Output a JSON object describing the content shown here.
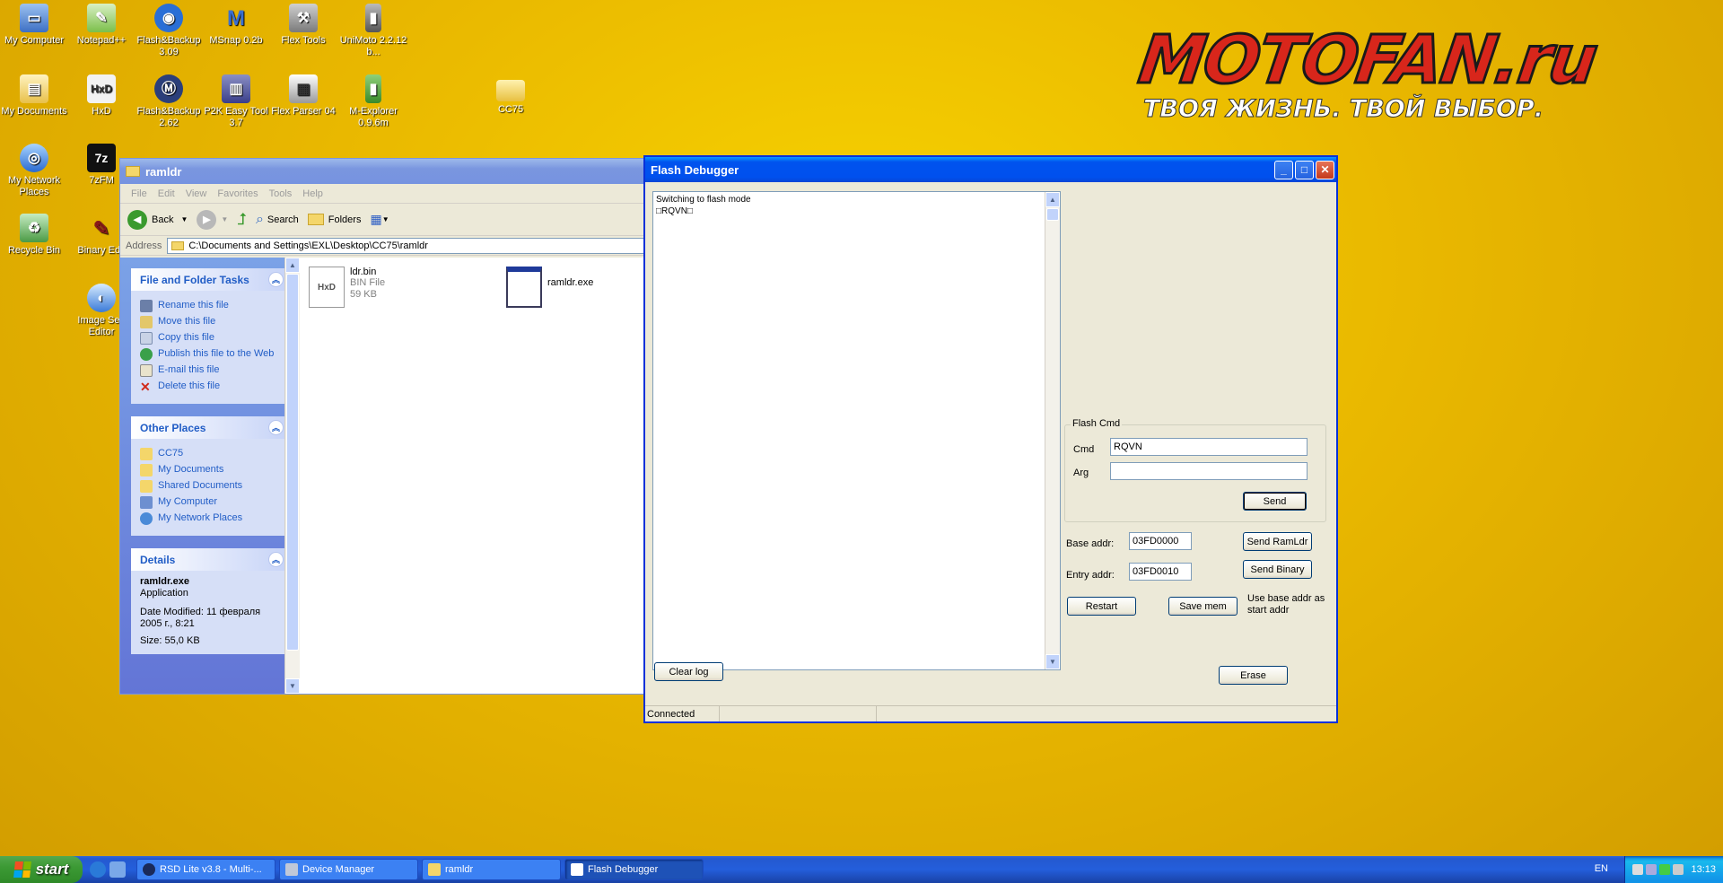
{
  "desktop": {
    "icons": [
      {
        "label": "My Computer"
      },
      {
        "label": "Notepad++"
      },
      {
        "label": "Flash&Backup 3.09"
      },
      {
        "label": "MSnap 0.2b"
      },
      {
        "label": "Flex Tools"
      },
      {
        "label": "UniMoto 2.2.12 b..."
      },
      {
        "label": "My Documents"
      },
      {
        "label": "HxD"
      },
      {
        "label": "Flash&Backup 2.62"
      },
      {
        "label": "P2K Easy Tool 3.7"
      },
      {
        "label": "Flex Parser 04"
      },
      {
        "label": "M-Explorer 0.9.6m"
      },
      {
        "label": "CC75"
      },
      {
        "label": "My Network Places"
      },
      {
        "label": "7zFM"
      },
      {
        "label": "Recycle Bin"
      },
      {
        "label": "Binary Edit"
      },
      {
        "label": "Image Sea Editor"
      }
    ],
    "logo": {
      "brand": "MOTOFAN.ru",
      "slogan": "ТВОЯ ЖИЗНЬ. ТВОЙ ВЫБОР."
    }
  },
  "explorer": {
    "title": "ramldr",
    "menu": [
      "File",
      "Edit",
      "View",
      "Favorites",
      "Tools",
      "Help"
    ],
    "toolbar": {
      "back": "Back",
      "search": "Search",
      "folders": "Folders"
    },
    "address_label": "Address",
    "address_value": "C:\\Documents and Settings\\EXL\\Desktop\\CC75\\ramldr",
    "tasks": {
      "title": "File and Folder Tasks",
      "items": [
        "Rename this file",
        "Move this file",
        "Copy this file",
        "Publish this file to the Web",
        "E-mail this file",
        "Delete this file"
      ]
    },
    "places": {
      "title": "Other Places",
      "items": [
        "CC75",
        "My Documents",
        "Shared Documents",
        "My Computer",
        "My Network Places"
      ]
    },
    "details": {
      "title": "Details",
      "name": "ramldr.exe",
      "type": "Application",
      "modified": "Date Modified: 11 февраля 2005 г., 8:21",
      "size": "Size: 55,0 KB"
    },
    "files": [
      {
        "name": "ldr.bin",
        "type": "BIN File",
        "size": "59 KB"
      },
      {
        "name": "ramldr.exe"
      }
    ]
  },
  "debugger": {
    "title": "Flash Debugger",
    "log_lines": [
      "Switching to flash mode",
      "□RQVN□"
    ],
    "flash_cmd_group": "Flash Cmd",
    "cmd_label": "Cmd",
    "cmd_value": "RQVN",
    "arg_label": "Arg",
    "arg_value": "",
    "send": "Send",
    "base_addr_label": "Base addr:",
    "base_addr_value": "03FD0000",
    "entry_addr_label": "Entry addr:",
    "entry_addr_value": "03FD0010",
    "send_ramldr": "Send RamLdr",
    "send_binary": "Send Binary",
    "restart": "Restart",
    "save_mem": "Save mem",
    "use_base_text": "Use base addr as start addr",
    "clear_log": "Clear log",
    "erase": "Erase",
    "status": "Connected"
  },
  "taskbar": {
    "start": "start",
    "tasks": [
      "RSD Lite v3.8 - Multi-...",
      "Device Manager",
      "ramldr",
      "Flash Debugger"
    ],
    "lang": "EN",
    "clock": "13:13"
  },
  "colors": {
    "desktop": "#e9b800",
    "xp_blue": "#0053ee",
    "link": "#215dc6"
  }
}
